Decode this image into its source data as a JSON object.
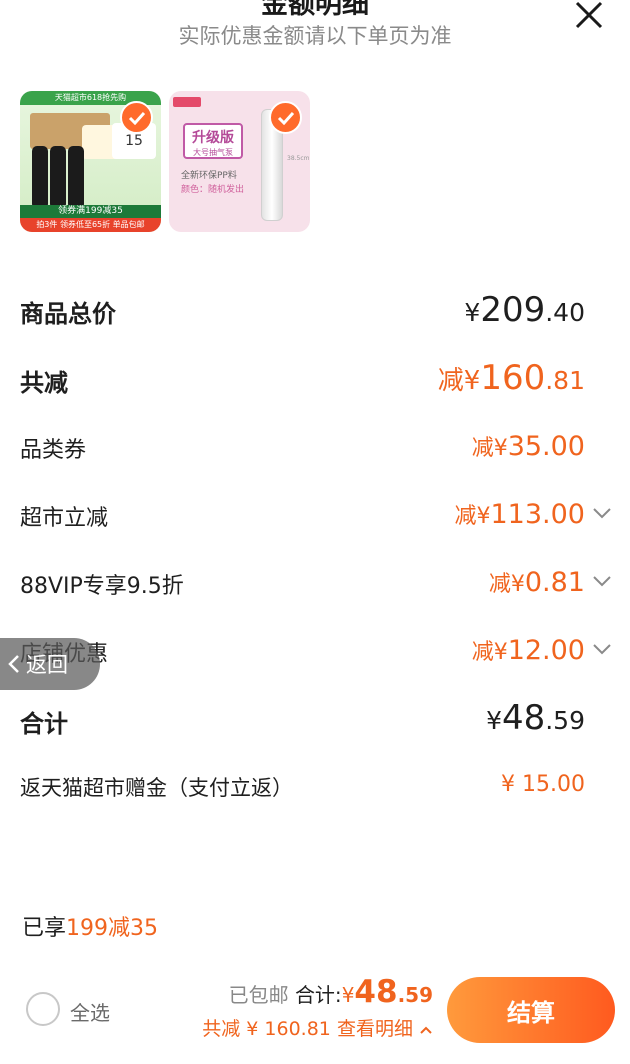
{
  "header": {
    "title": "金额明细",
    "subtitle": "实际优惠金额请以下单页为准"
  },
  "products": [
    {
      "banner": "天猫超市618抢先购",
      "card_text": "15",
      "promo": "领券满199减35",
      "bar": "拍3件 领券低至65折 单品包邮",
      "selected": true
    },
    {
      "badge_big": "升级版",
      "badge_small": "大号抽气泵",
      "line1": "全新环保PP料",
      "line2": "颜色：随机发出",
      "dim": "38.5cm",
      "selected": true
    }
  ],
  "summary": {
    "total_label": "商品总价",
    "total_prefix": "¥",
    "total_int": "209",
    "total_dec": ".40",
    "reduce_label": "共减",
    "reduce_prefix": "减¥",
    "reduce_int": "160",
    "reduce_dec": ".81",
    "coupon_label": "品类券",
    "coupon_prefix": "减¥",
    "coupon_int": "35",
    "coupon_dec": ".00",
    "market_label": "超市立减",
    "market_prefix": "减¥",
    "market_int": "113",
    "market_dec": ".00",
    "vip_label": "88VIP专享9.5折",
    "vip_prefix": "减¥",
    "vip_int": "0",
    "vip_dec": ".81",
    "store_label": "店铺优惠",
    "store_prefix": "减¥",
    "store_int": "12",
    "store_dec": ".00",
    "sum_label": "合计",
    "sum_prefix": "¥",
    "sum_int": "48",
    "sum_dec": ".59",
    "rebate_label": "返天猫超市赠金（支付立返）",
    "rebate_value": "¥ 15.00"
  },
  "back_button": "返回",
  "enjoyed": {
    "prefix": "已享",
    "value": "199减35"
  },
  "footer": {
    "select_all": "全选",
    "shipping": "已包邮",
    "total_label": "合计:",
    "total_prefix": "¥",
    "total_int": "48",
    "total_dec": ".59",
    "saved": "共减 ¥ 160.81",
    "view_detail": "查看明细",
    "pay": "结算"
  },
  "colors": {
    "accent": "#f0641e",
    "check": "#ff6a2b",
    "pay_start": "#ff9a3c",
    "pay_end": "#ff5a1f"
  }
}
